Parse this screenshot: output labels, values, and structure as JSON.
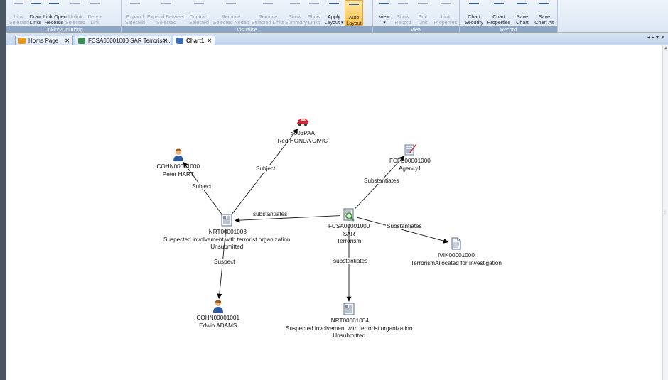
{
  "ribbon": {
    "groups": [
      {
        "label": "Linking/Unlinking",
        "buttons": [
          {
            "label": "Link\nSelected",
            "enabled": false
          },
          {
            "label": "Draw\nLinks",
            "enabled": true
          },
          {
            "label": "Link Open\nRecords",
            "enabled": true
          },
          {
            "label": "Unlink\nSelected",
            "enabled": false
          },
          {
            "label": "Delete\nLink",
            "enabled": false
          }
        ]
      },
      {
        "label": "Visualise",
        "buttons": [
          {
            "label": "Expand\nSelected",
            "enabled": false
          },
          {
            "label": "Expand Between\nSelected",
            "enabled": false
          },
          {
            "label": "Contract\nSelected",
            "enabled": false
          },
          {
            "label": "Remove\nSelected Nodes",
            "enabled": false
          },
          {
            "label": "Remove\nSelected Links",
            "enabled": false
          },
          {
            "label": "Show\nSummary",
            "enabled": false
          },
          {
            "label": "Show\nLinks",
            "enabled": false
          },
          {
            "label": "Apply\nLayout ▾",
            "enabled": true
          },
          {
            "label": "Auto\nLayout",
            "enabled": true,
            "highlighted": true
          }
        ]
      },
      {
        "label": "View",
        "buttons": [
          {
            "label": "View\n▾",
            "enabled": true
          },
          {
            "label": "Show\nRecord",
            "enabled": false
          },
          {
            "label": "Edit\nLink",
            "enabled": false
          },
          {
            "label": "Link\nProperties",
            "enabled": false
          }
        ]
      },
      {
        "label": "Record",
        "buttons": [
          {
            "label": "Chart\nSecurity",
            "enabled": true
          },
          {
            "label": "Chart\nProperties",
            "enabled": true
          },
          {
            "label": "Save\nChart",
            "enabled": true
          },
          {
            "label": "Save\nChart As",
            "enabled": true
          }
        ]
      }
    ]
  },
  "tabs": [
    {
      "label": "Home Page",
      "icon": "home-icon",
      "close": "✕"
    },
    {
      "label": "FCSA00001000 SAR Terrorism...",
      "icon": "record-icon",
      "close": "✕"
    },
    {
      "label": "Chart1",
      "icon": "chart-icon",
      "close": "✕",
      "active": true
    }
  ],
  "tab_nav": "◂ ▸ ▾ ✕",
  "nodes": [
    {
      "id": "vehicle",
      "icon": "car-icon",
      "lines": [
        "SJ03PAA",
        "Red HONDA CIVIC"
      ]
    },
    {
      "id": "peter",
      "icon": "person-icon",
      "lines": [
        "COHN00001000",
        "Peter HART"
      ]
    },
    {
      "id": "agency",
      "icon": "document-sign-icon",
      "lines": [
        "FCFB00001000",
        "Agency1"
      ]
    },
    {
      "id": "inrt1003",
      "icon": "report-icon",
      "lines": [
        "INRT00001003",
        "Suspected involvement with terrorist organization",
        "Unsubmitted"
      ]
    },
    {
      "id": "fcsa",
      "icon": "sar-icon",
      "lines": [
        "FCSA00001000",
        "SAR",
        "Terrorism"
      ]
    },
    {
      "id": "ivik",
      "icon": "file-icon",
      "lines": [
        "IVIK00001000",
        "TerrorismAllocated for Investigation"
      ]
    },
    {
      "id": "edwin",
      "icon": "person-icon",
      "lines": [
        "COHN00001001",
        "Edwin ADAMS"
      ]
    },
    {
      "id": "inrt1004",
      "icon": "report-icon",
      "lines": [
        "INRT00001004",
        "Suspected involvement with terrorist organization",
        "Unsubmitted"
      ]
    }
  ],
  "links": [
    {
      "from": "inrt1003",
      "to": "peter",
      "label": "Subject"
    },
    {
      "from": "inrt1003",
      "to": "vehicle",
      "label": "Subject"
    },
    {
      "from": "fcsa",
      "to": "inrt1003",
      "label": "substantiates"
    },
    {
      "from": "fcsa",
      "to": "agency",
      "label": "Substantiates"
    },
    {
      "from": "fcsa",
      "to": "ivik",
      "label": "Substantiates"
    },
    {
      "from": "inrt1003",
      "to": "edwin",
      "label": "Suspect"
    },
    {
      "from": "fcsa",
      "to": "inrt1004",
      "label": "substantiates"
    }
  ]
}
